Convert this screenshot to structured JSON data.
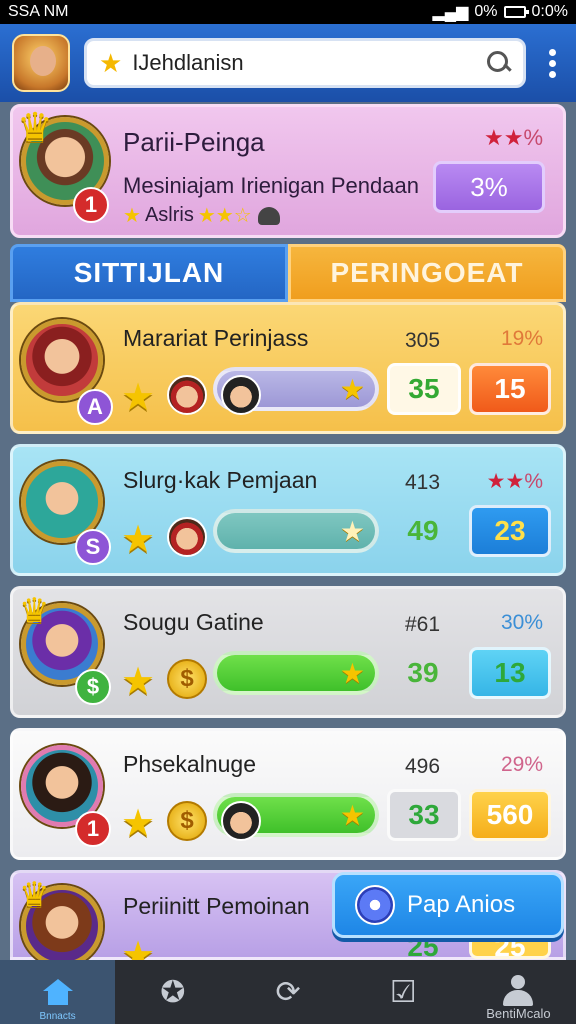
{
  "status_bar": {
    "left": "SSA NM",
    "battery": "0%",
    "time": "0:0%"
  },
  "header": {
    "search_value": "IJehdlanisn"
  },
  "player": {
    "name": "Parii-Peinga",
    "subtitle": "Mesiniajam Irienigan Pendaan",
    "tag": "Aslris",
    "rating": "%",
    "badge": "1",
    "button": "3%"
  },
  "tabs": [
    {
      "label": "SITTIJLAN"
    },
    {
      "label": "PERINGOEAT"
    }
  ],
  "rows": [
    {
      "name": "Marariat Perinjass",
      "score": "305",
      "pct": "19%",
      "badge": "A",
      "slot1": "35",
      "slot2": "15"
    },
    {
      "name": "Slurg·kak Pemjaan",
      "score": "413",
      "pct": "%",
      "badge": "S",
      "slot1": "49",
      "slot2": "23"
    },
    {
      "name": "Sougu Gatine",
      "score": "#61",
      "pct": "30%",
      "badge": "$",
      "slot1": "39",
      "slot2": "13"
    },
    {
      "name": "Phsekalnuge",
      "score": "496",
      "pct": "29%",
      "badge": "1",
      "slot1": "33",
      "slot2": "560"
    },
    {
      "name": "Periinitt Pemoinan",
      "slot1": "25",
      "slot2": "25"
    }
  ],
  "fab": {
    "label": "Pap Anios"
  },
  "nav": {
    "home_label": "Bnnacts",
    "profile_label": "BentiMcalo"
  },
  "icons": [
    "signal-icon",
    "battery-icon",
    "star-icon",
    "search-icon",
    "more-icon",
    "home-icon",
    "star-person-icon",
    "refresh-icon",
    "check-icon",
    "profile-icon"
  ]
}
